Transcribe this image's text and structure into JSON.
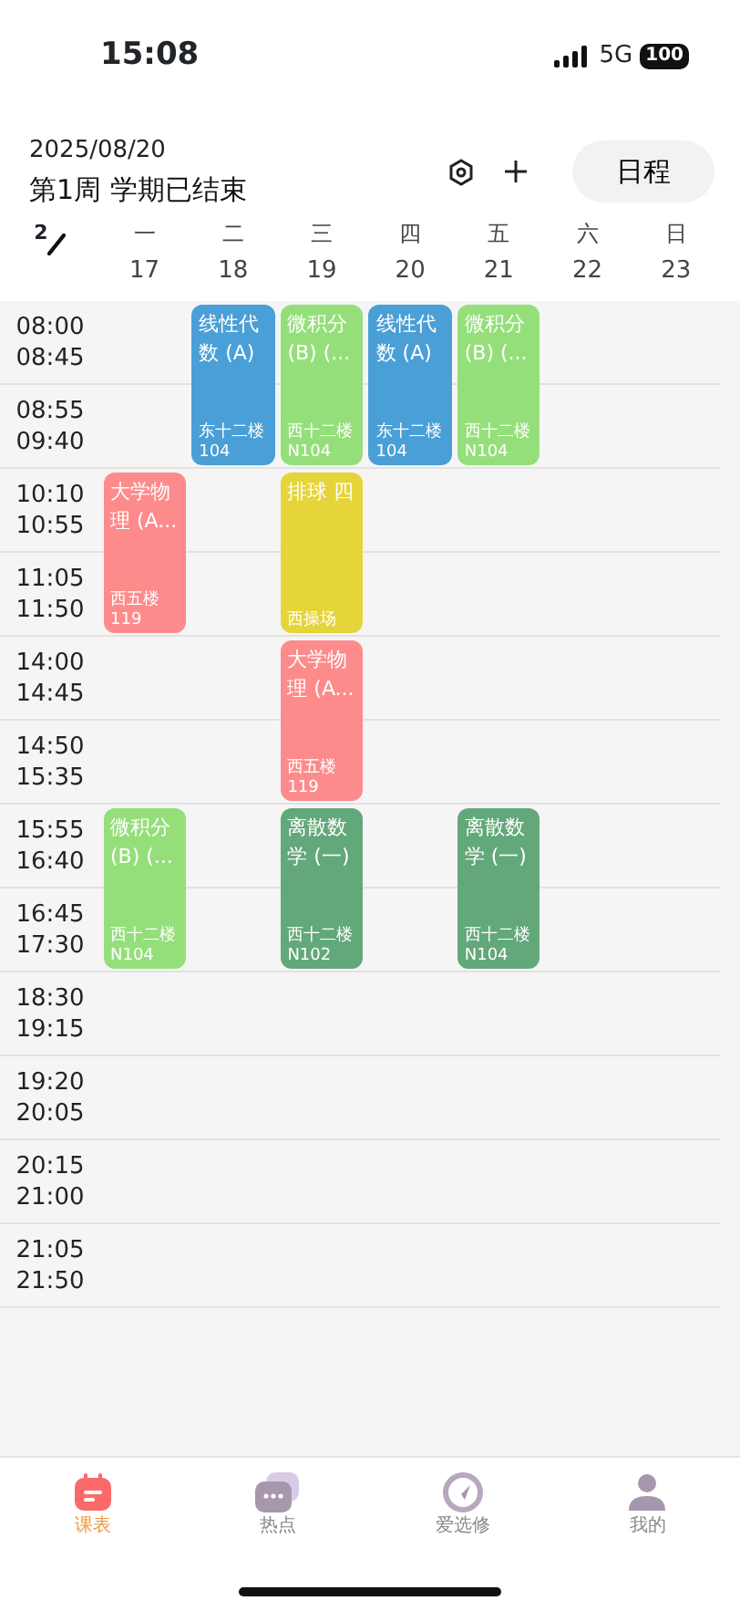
{
  "status_bar": {
    "time": "15:08",
    "network": "5G",
    "battery": "100"
  },
  "header": {
    "date": "2025/08/20",
    "title": "第1周 学期已结束",
    "schedule_button": "日程"
  },
  "week_header": {
    "month": "2",
    "days": [
      {
        "weekday": "一",
        "date": "17"
      },
      {
        "weekday": "二",
        "date": "18"
      },
      {
        "weekday": "三",
        "date": "19"
      },
      {
        "weekday": "四",
        "date": "20"
      },
      {
        "weekday": "五",
        "date": "21"
      },
      {
        "weekday": "六",
        "date": "22"
      },
      {
        "weekday": "日",
        "date": "23"
      }
    ]
  },
  "blocks": [
    {
      "periods": [
        {
          "start": "08:00",
          "end": "08:45"
        },
        {
          "start": "08:55",
          "end": "09:40"
        }
      ],
      "cells": [
        {
          "kind": "empty"
        },
        {
          "kind": "course",
          "color": "#4a9fd6",
          "name_lines": [
            "线性代",
            "数 (A)"
          ],
          "location_lines": [
            "东十二楼",
            "104"
          ]
        },
        {
          "kind": "course",
          "color": "#95df7b",
          "name_lines": [
            "微积分",
            "(B) (..."
          ],
          "location_lines": [
            "西十二楼",
            "N104"
          ]
        },
        {
          "kind": "course",
          "color": "#4a9fd6",
          "name_lines": [
            "线性代",
            "数 (A)"
          ],
          "location_lines": [
            "东十二楼",
            "104"
          ]
        },
        {
          "kind": "course",
          "color": "#95df7b",
          "name_lines": [
            "微积分",
            "(B) (..."
          ],
          "location_lines": [
            "西十二楼",
            "N104"
          ]
        },
        {
          "kind": "empty"
        },
        {
          "kind": "empty"
        }
      ]
    },
    {
      "periods": [
        {
          "start": "10:10",
          "end": "10:55"
        },
        {
          "start": "11:05",
          "end": "11:50"
        }
      ],
      "cells": [
        {
          "kind": "course",
          "color": "#fd8b8b",
          "name_lines": [
            "大学物",
            "理 (A..."
          ],
          "location_lines": [
            "西五楼",
            "119"
          ]
        },
        {
          "kind": "empty"
        },
        {
          "kind": "course",
          "color": "#e5d43a",
          "name_lines": [
            "排球 四"
          ],
          "location_lines": [
            "西操场"
          ]
        },
        {
          "kind": "empty"
        },
        {
          "kind": "empty"
        },
        {
          "kind": "empty"
        },
        {
          "kind": "empty"
        }
      ]
    },
    {
      "periods": [
        {
          "start": "14:00",
          "end": "14:45"
        },
        {
          "start": "14:50",
          "end": "15:35"
        }
      ],
      "cells": [
        {
          "kind": "empty"
        },
        {
          "kind": "empty"
        },
        {
          "kind": "course",
          "color": "#fd8b8b",
          "name_lines": [
            "大学物",
            "理 (A..."
          ],
          "location_lines": [
            "西五楼",
            "119"
          ]
        },
        {
          "kind": "empty"
        },
        {
          "kind": "empty"
        },
        {
          "kind": "empty"
        },
        {
          "kind": "empty"
        }
      ]
    },
    {
      "periods": [
        {
          "start": "15:55",
          "end": "16:40"
        },
        {
          "start": "16:45",
          "end": "17:30"
        }
      ],
      "cells": [
        {
          "kind": "course",
          "color": "#95df7b",
          "name_lines": [
            "微积分",
            "(B) (..."
          ],
          "location_lines": [
            "西十二楼",
            "N104"
          ]
        },
        {
          "kind": "empty"
        },
        {
          "kind": "course",
          "color": "#63a87a",
          "name_lines": [
            "离散数",
            "学 (一)"
          ],
          "location_lines": [
            "西十二楼",
            "N102"
          ]
        },
        {
          "kind": "empty"
        },
        {
          "kind": "course",
          "color": "#63a87a",
          "name_lines": [
            "离散数",
            "学 (一)"
          ],
          "location_lines": [
            "西十二楼",
            "N104"
          ]
        },
        {
          "kind": "empty"
        },
        {
          "kind": "empty"
        }
      ]
    },
    {
      "periods": [
        {
          "start": "18:30",
          "end": "19:15"
        },
        {
          "start": "19:20",
          "end": "20:05"
        }
      ],
      "cells": [
        {
          "kind": "empty"
        },
        {
          "kind": "empty"
        },
        {
          "kind": "empty"
        },
        {
          "kind": "empty"
        },
        {
          "kind": "empty"
        },
        {
          "kind": "empty"
        },
        {
          "kind": "empty"
        }
      ]
    },
    {
      "periods": [
        {
          "start": "20:15",
          "end": "21:00"
        },
        {
          "start": "21:05",
          "end": "21:50"
        }
      ],
      "cells": [
        {
          "kind": "empty"
        },
        {
          "kind": "empty"
        },
        {
          "kind": "empty"
        },
        {
          "kind": "empty"
        },
        {
          "kind": "empty"
        },
        {
          "kind": "empty"
        },
        {
          "kind": "empty"
        }
      ]
    }
  ],
  "tab_bar": [
    {
      "kind": "calendar",
      "label": "课表",
      "selected": true
    },
    {
      "kind": "chat",
      "label": "热点",
      "selected": false
    },
    {
      "kind": "compass",
      "label": "爱选修",
      "selected": false
    },
    {
      "kind": "person",
      "label": "我的",
      "selected": false
    }
  ]
}
